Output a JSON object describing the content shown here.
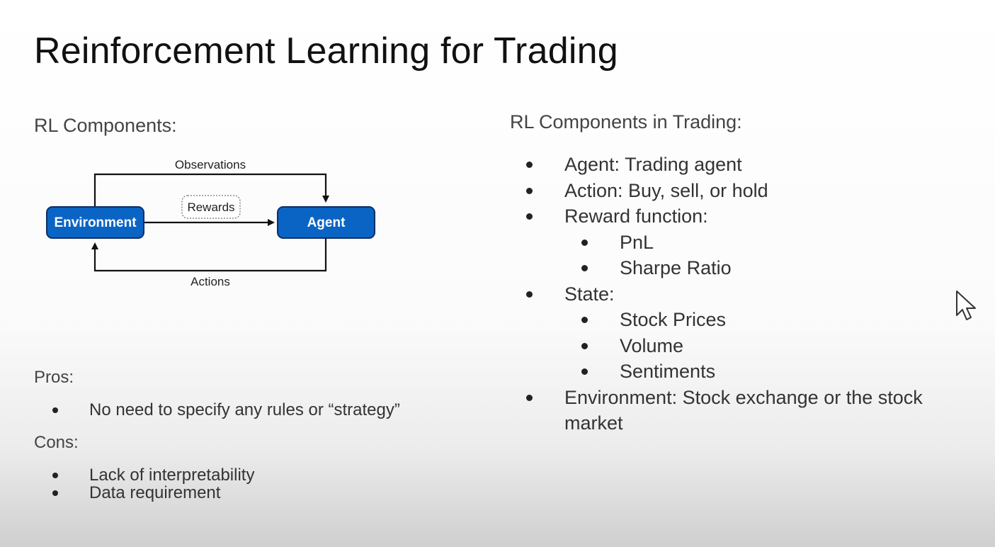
{
  "slide": {
    "title": "Reinforcement Learning for Trading"
  },
  "left": {
    "heading": "RL Components:",
    "diagram": {
      "environment_label": "Environment",
      "agent_label": "Agent",
      "observations_label": "Observations",
      "rewards_label": "Rewards",
      "actions_label": "Actions",
      "box_color": "#0a64c4",
      "box_border": "#0b2f6b"
    },
    "pros": {
      "heading": "Pros:",
      "items": [
        "No need to specify any rules or “strategy”"
      ]
    },
    "cons": {
      "heading": "Cons:",
      "items": [
        "Lack of interpretability",
        "Data requirement"
      ]
    }
  },
  "right": {
    "heading": "RL Components in Trading:",
    "items": [
      {
        "text": "Agent: Trading agent",
        "level": 1
      },
      {
        "text": "Action: Buy, sell, or hold",
        "level": 1
      },
      {
        "text": "Reward function:",
        "level": 1
      },
      {
        "text": "PnL",
        "level": 2
      },
      {
        "text": "Sharpe Ratio",
        "level": 2
      },
      {
        "text": "State:",
        "level": 1
      },
      {
        "text": "Stock Prices",
        "level": 2
      },
      {
        "text": "Volume",
        "level": 2
      },
      {
        "text": "Sentiments",
        "level": 2
      },
      {
        "text": "Environment: Stock exchange or the stock market",
        "level": 1
      }
    ]
  },
  "cursor": {
    "icon": "mouse-pointer-icon"
  }
}
